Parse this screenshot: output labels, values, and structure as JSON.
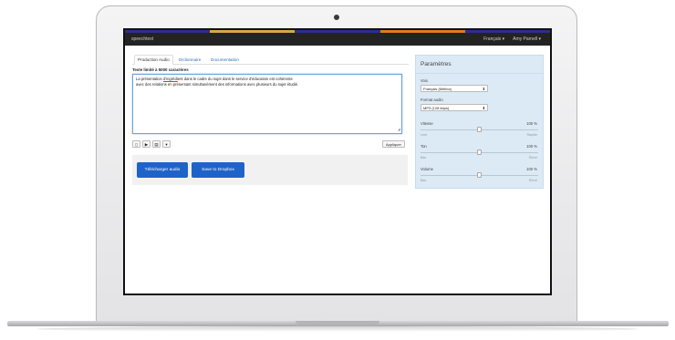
{
  "app": {
    "brand": "speechtext",
    "stripe_colors": [
      "#2b2f8f",
      "#d9a84a",
      "#2b2f8f",
      "#e07a1f",
      "#2b2f8f"
    ],
    "nav": {
      "language": "Français ▾",
      "user": "Amy Parnell ▾"
    }
  },
  "tabs": [
    {
      "label": "Production Audio"
    },
    {
      "label": "Dictionnaire"
    },
    {
      "label": "Documentation"
    }
  ],
  "editor": {
    "limit_label": "Texte limité à 5000 caractères",
    "text_line1_a": "La présentation ",
    "text_line1_err": "d'ingrédi",
    "text_line1_b": "ent dans le cadre du sujet dans le service d'éducation est cohérente",
    "text_line2": "avec des relations en présentant simultanément des informations avec plusieurs du sujet étudié.",
    "apply_label": "Appliquer"
  },
  "toolbar": {
    "doc_icon": "▯",
    "play_icon": "▶",
    "save_icon": "▤",
    "more_icon": "▾"
  },
  "actions": {
    "download_label": "Télécharger audio",
    "dropbox_label": "Save to Dropbox"
  },
  "params": {
    "title": "Paramètres",
    "voice_label": "Voix",
    "voice_value": "Français (Mélina)",
    "format_label": "Format audio",
    "format_value": "MP3 (128 kbps)",
    "speed": {
      "label": "Vitesse",
      "value": "100 %",
      "min_label": "Lent",
      "max_label": "Rapide",
      "level": 0.5
    },
    "pitch": {
      "label": "Ton",
      "value": "100 %",
      "min_label": "Bas",
      "max_label": "Élevé",
      "level": 0.5
    },
    "volume": {
      "label": "Volume",
      "value": "100 %",
      "min_label": "Bas",
      "max_label": "Élevé",
      "level": 0.5
    }
  }
}
